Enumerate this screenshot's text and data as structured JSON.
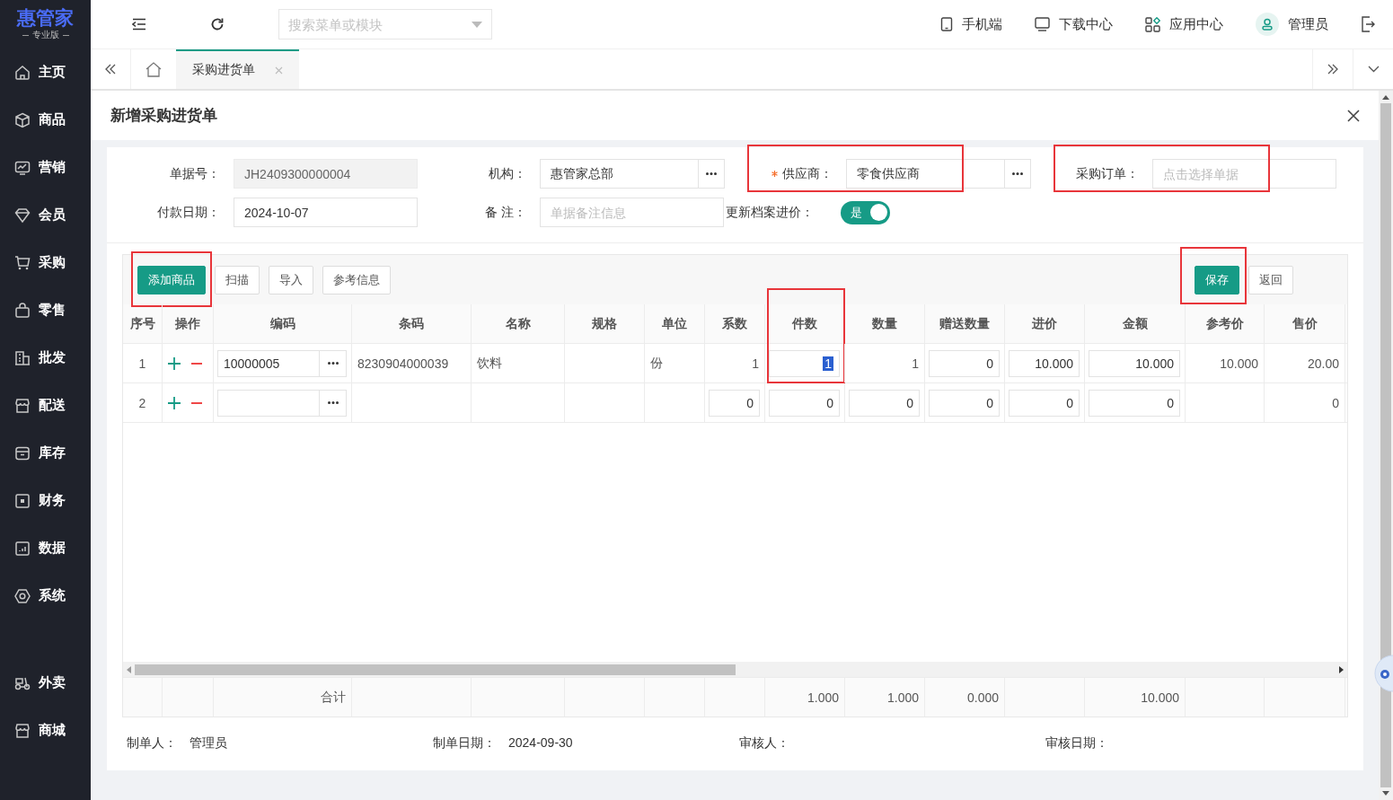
{
  "logo": {
    "name": "惠管家",
    "edition": "专业版"
  },
  "sidebar": {
    "groups": [
      [
        {
          "label": "主页"
        },
        {
          "label": "商品"
        },
        {
          "label": "营销"
        },
        {
          "label": "会员"
        },
        {
          "label": "采购"
        },
        {
          "label": "零售"
        },
        {
          "label": "批发"
        },
        {
          "label": "配送"
        },
        {
          "label": "库存"
        },
        {
          "label": "财务"
        },
        {
          "label": "数据"
        },
        {
          "label": "系统"
        }
      ],
      [
        {
          "label": "外卖"
        },
        {
          "label": "商城"
        }
      ]
    ]
  },
  "topbar": {
    "search": {
      "placeholder": "搜索菜单或模块"
    },
    "links": [
      {
        "label": "手机端"
      },
      {
        "label": "下载中心"
      },
      {
        "label": "应用中心"
      }
    ],
    "user": "管理员"
  },
  "tabs": [
    {
      "label": "采购进货单",
      "selected": true
    }
  ],
  "page": {
    "title": "新增采购进货单"
  },
  "form": {
    "fields": [
      {
        "label": "单据号：",
        "value": "JH2409300000004",
        "readonly": true,
        "picker": false,
        "required": false,
        "highlighted": false
      },
      {
        "label": "机构：",
        "value": "惠管家总部",
        "readonly": false,
        "picker": true,
        "required": false,
        "highlighted": false
      },
      {
        "label": "供应商：",
        "value": "零食供应商",
        "readonly": false,
        "picker": true,
        "required": true,
        "highlighted": true
      },
      {
        "label": "采购订单：",
        "placeholder": "点击选择单据",
        "readonly": false,
        "picker": false,
        "required": false,
        "highlighted": true
      },
      {
        "label": "付款日期：",
        "value": "2024-10-07",
        "readonly": false,
        "picker": false,
        "required": false,
        "highlighted": false
      },
      {
        "label": "备 注：",
        "placeholder": "单据备注信息",
        "readonly": false,
        "picker": false,
        "required": false,
        "highlighted": false
      }
    ],
    "toggle": {
      "label": "更新档案进价：",
      "text": "是",
      "on": true
    }
  },
  "toolbar": {
    "left": [
      {
        "label": "添加商品",
        "primary": true,
        "highlighted": true
      },
      {
        "label": "扫描",
        "primary": false,
        "highlighted": false
      },
      {
        "label": "导入",
        "primary": false,
        "highlighted": false
      },
      {
        "label": "参考信息",
        "primary": false,
        "highlighted": false
      }
    ],
    "right": [
      {
        "label": "保存",
        "primary": true,
        "highlighted": true
      },
      {
        "label": "返回",
        "primary": false,
        "highlighted": false
      }
    ]
  },
  "table": {
    "columns": [
      {
        "label": "序号",
        "highlighted": false
      },
      {
        "label": "操作",
        "highlighted": false
      },
      {
        "label": "编码",
        "highlighted": false
      },
      {
        "label": "条码",
        "highlighted": false
      },
      {
        "label": "名称",
        "highlighted": false
      },
      {
        "label": "规格",
        "highlighted": false
      },
      {
        "label": "单位",
        "highlighted": false
      },
      {
        "label": "系数",
        "highlighted": false
      },
      {
        "label": "件数",
        "highlighted": true
      },
      {
        "label": "数量",
        "highlighted": false
      },
      {
        "label": "赠送数量",
        "highlighted": false
      },
      {
        "label": "进价",
        "highlighted": false
      },
      {
        "label": "金额",
        "highlighted": false
      },
      {
        "label": "参考价",
        "highlighted": false
      },
      {
        "label": "售价",
        "highlighted": false
      }
    ],
    "rows": [
      [
        {
          "kind": "index",
          "value": "1"
        },
        {
          "kind": "ops"
        },
        {
          "kind": "input",
          "value": "10000005",
          "picker": true
        },
        {
          "kind": "text",
          "value": "8230904000039"
        },
        {
          "kind": "text",
          "value": "饮料"
        },
        {
          "kind": "blank"
        },
        {
          "kind": "text",
          "value": "份"
        },
        {
          "kind": "number",
          "value": "1"
        },
        {
          "kind": "input",
          "value": "1",
          "focused": true
        },
        {
          "kind": "number",
          "value": "1"
        },
        {
          "kind": "input",
          "value": "0"
        },
        {
          "kind": "input",
          "value": "10.000"
        },
        {
          "kind": "input",
          "value": "10.000"
        },
        {
          "kind": "number",
          "value": "10.000"
        },
        {
          "kind": "number",
          "value": "20.00"
        }
      ],
      [
        {
          "kind": "index",
          "value": "2"
        },
        {
          "kind": "ops"
        },
        {
          "kind": "input",
          "picker": true
        },
        {
          "kind": "blank"
        },
        {
          "kind": "blank"
        },
        {
          "kind": "blank"
        },
        {
          "kind": "blank"
        },
        {
          "kind": "input",
          "value": "0"
        },
        {
          "kind": "input",
          "value": "0"
        },
        {
          "kind": "input",
          "value": "0"
        },
        {
          "kind": "input",
          "value": "0"
        },
        {
          "kind": "input",
          "value": "0"
        },
        {
          "kind": "input",
          "value": "0"
        },
        {
          "kind": "blank"
        },
        {
          "kind": "number",
          "value": "0"
        }
      ]
    ],
    "totals": [
      {
        "kind": "blank"
      },
      {
        "kind": "blank"
      },
      {
        "kind": "label",
        "value": "合计"
      },
      {
        "kind": "blank"
      },
      {
        "kind": "blank"
      },
      {
        "kind": "blank"
      },
      {
        "kind": "blank"
      },
      {
        "kind": "blank"
      },
      {
        "kind": "number",
        "value": "1.000"
      },
      {
        "kind": "number",
        "value": "1.000"
      },
      {
        "kind": "number",
        "value": "0.000"
      },
      {
        "kind": "blank"
      },
      {
        "kind": "number",
        "value": "10.000"
      },
      {
        "kind": "blank"
      },
      {
        "kind": "blank"
      }
    ]
  },
  "footer": [
    {
      "label": "制单人：",
      "value": "管理员"
    },
    {
      "label": "制单日期：",
      "value": "2024-09-30"
    },
    {
      "label": "审核人："
    },
    {
      "label": "审核日期："
    }
  ]
}
